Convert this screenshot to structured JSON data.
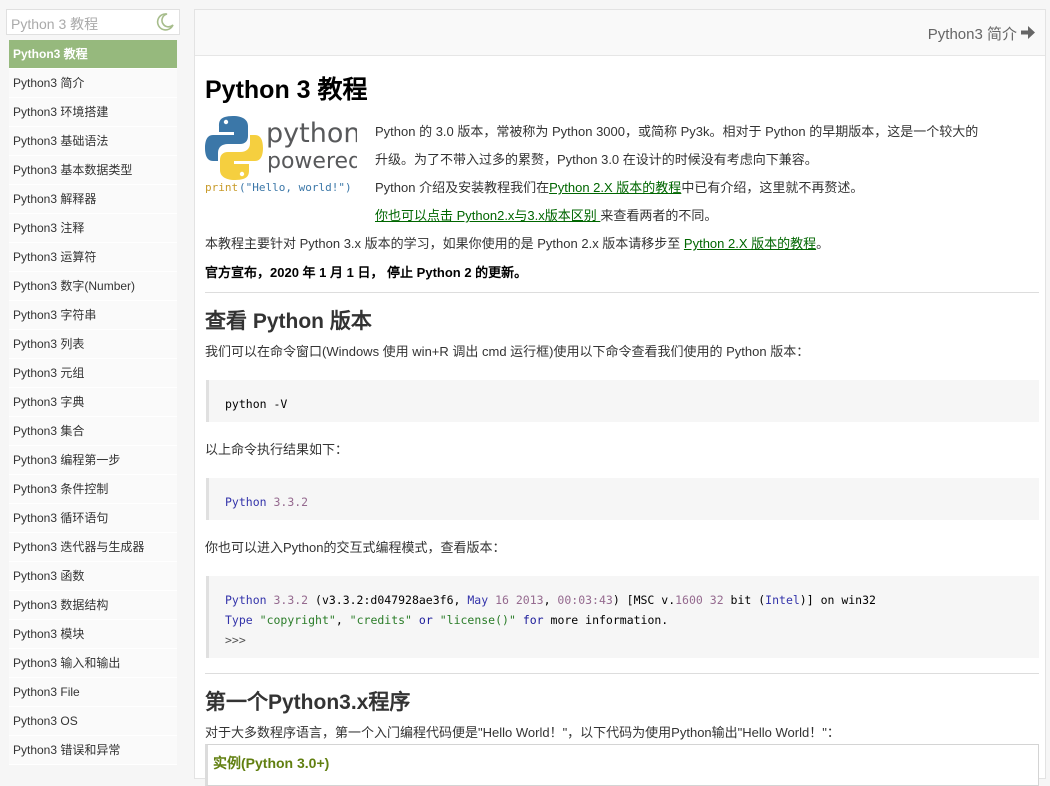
{
  "sidebar": {
    "search_placeholder": "Python 3 教程",
    "items": [
      {
        "label": "Python3 教程"
      },
      {
        "label": "Python3 简介"
      },
      {
        "label": "Python3 环境搭建"
      },
      {
        "label": "Python3 基础语法"
      },
      {
        "label": "Python3 基本数据类型"
      },
      {
        "label": "Python3 解释器"
      },
      {
        "label": "Python3 注释"
      },
      {
        "label": "Python3 运算符"
      },
      {
        "label": "Python3 数字(Number)"
      },
      {
        "label": "Python3 字符串"
      },
      {
        "label": "Python3 列表"
      },
      {
        "label": "Python3 元组"
      },
      {
        "label": "Python3 字典"
      },
      {
        "label": "Python3 集合"
      },
      {
        "label": "Python3 编程第一步"
      },
      {
        "label": "Python3 条件控制"
      },
      {
        "label": "Python3 循环语句"
      },
      {
        "label": "Python3 迭代器与生成器"
      },
      {
        "label": "Python3 函数"
      },
      {
        "label": "Python3 数据结构"
      },
      {
        "label": "Python3 模块"
      },
      {
        "label": "Python3 输入和输出"
      },
      {
        "label": "Python3 File"
      },
      {
        "label": "Python3 OS"
      },
      {
        "label": "Python3 错误和异常"
      }
    ]
  },
  "topbar": {
    "next_label": "Python3 简介"
  },
  "article": {
    "title": "Python 3 教程",
    "logo": {
      "word1": "python",
      "word2": "powered",
      "code_print": "print",
      "code_arg": "(\"Hello, world!\")"
    },
    "intro1": "Python 的 3.0 版本，常被称为 Python 3000，或简称 Py3k。相对于 Python 的早期版本，这是一个较大的",
    "intro2": "升级。为了不带入过多的累赘，Python 3.0 在设计的时候没有考虑向下兼容。",
    "intro3_pre": "Python 介绍及安装教程我们在",
    "intro3_link": "Python 2.X 版本的教程",
    "intro3_post": "中已有介绍，这里就不再赘述。",
    "intro4_link": "你也可以点击 Python2.x与3.x版本区别 ",
    "intro4_post": "来查看两者的不同。",
    "intro5_pre": "本教程主要针对 Python 3.x 版本的学习，如果你使用的是 Python 2.x 版本请移步至 ",
    "intro5_link": "Python 2.X 版本的教程",
    "intro5_post": "。",
    "announce": "官方宣布，2020 年 1 月 1 日， 停止 Python 2 的更新。",
    "h2_version": "查看 Python 版本",
    "version_desc": "我们可以在命令窗口(Windows 使用 win+R 调出 cmd 运行框)使用以下命令查看我们使用的 Python 版本：",
    "code1": {
      "a": "python ",
      "b": "-V"
    },
    "result_desc": "以上命令执行结果如下：",
    "code2": {
      "a": "Python ",
      "b": "3.3.2"
    },
    "interactive_desc": "你也可以进入Python的交互式编程模式，查看版本：",
    "code3": {
      "l1a": "Python ",
      "l1b": "3.3.2",
      "l1c": " (v3.3.2:d047928ae3f6, ",
      "l1d": "May",
      "l1e": " ",
      "l1f": "16",
      "l1g": " ",
      "l1h": "2013",
      "l1i": ", ",
      "l1j": "00:03:43",
      "l1k": ") [MSC v.",
      "l1l": "1600",
      "l1m": " ",
      "l1n": "32",
      "l1o": " bit (",
      "l1p": "Intel",
      "l1q": ")] on win32",
      "l2a": "Type",
      "l2b": " ",
      "l2c": "\"copyright\"",
      "l2d": ", ",
      "l2e": "\"credits\"",
      "l2f": " ",
      "l2g": "or",
      "l2h": " ",
      "l2i": "\"license()\"",
      "l2j": " ",
      "l2k": "for",
      "l2l": " more information.",
      "l3": ">>>"
    },
    "h2_first": "第一个Python3.x程序",
    "first_desc": "对于大多数程序语言，第一个入门编程代码便是\"Hello World！\"，以下代码为使用Python输出\"Hello World！\"：",
    "example_title": "实例(Python 3.0+)"
  },
  "colors": {
    "sidebar_active": "#96b97d",
    "link": "#006600",
    "example_title": "#617f10"
  }
}
